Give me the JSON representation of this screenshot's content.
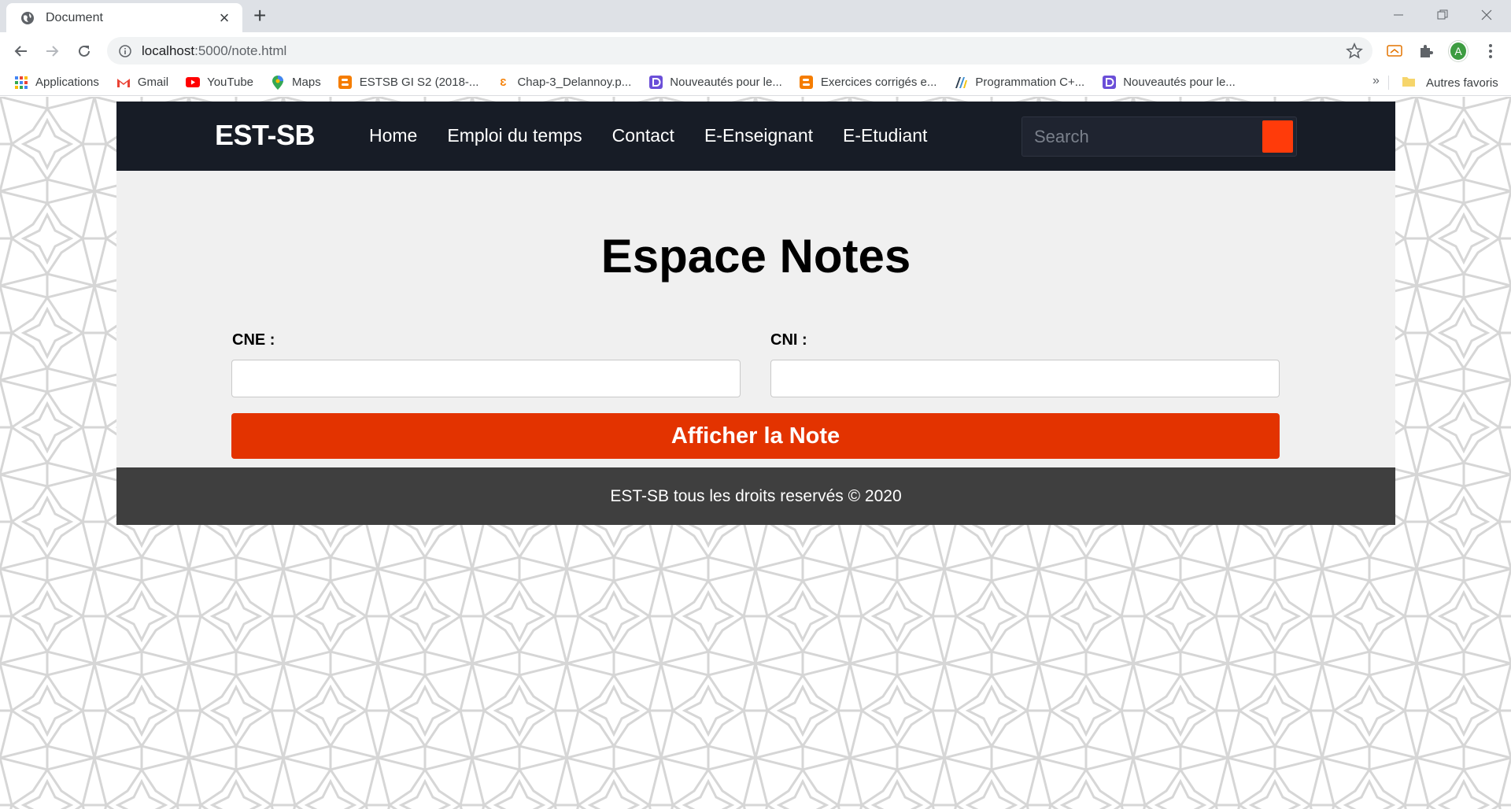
{
  "browser": {
    "tab_title": "Document",
    "url_host": "localhost",
    "url_path": ":5000/note.html",
    "profile_initial": "A",
    "bookmarks": [
      {
        "label": "Applications",
        "icon": "apps-grid-icon"
      },
      {
        "label": "Gmail",
        "icon": "gmail-icon"
      },
      {
        "label": "YouTube",
        "icon": "youtube-icon"
      },
      {
        "label": "Maps",
        "icon": "maps-icon"
      },
      {
        "label": "ESTSB GI S2 (2018-...",
        "icon": "blogger-icon"
      },
      {
        "label": "Chap-3_Delannoy.p...",
        "icon": "doc-e-icon"
      },
      {
        "label": "Nouveautés pour le...",
        "icon": "purple-d-icon"
      },
      {
        "label": "Exercices corrigés e...",
        "icon": "blogger-icon"
      },
      {
        "label": "Programmation C+...",
        "icon": "programming-icon"
      },
      {
        "label": "Nouveautés pour le...",
        "icon": "purple-d-icon"
      }
    ],
    "more_bookmarks": "»",
    "other_bookmarks": "Autres favoris"
  },
  "site": {
    "brand": "EST-SB",
    "nav": [
      "Home",
      "Emploi du temps",
      "Contact",
      "E-Enseignant",
      "E-Etudiant"
    ],
    "search_placeholder": "Search",
    "accent_color": "#ff3b0a"
  },
  "main": {
    "heading": "Espace Notes",
    "cne_label": "CNE :",
    "cni_label": "CNI :",
    "cne_value": "",
    "cni_value": "",
    "submit_label": "Afficher la Note",
    "button_color": "#e33300"
  },
  "footer": {
    "text": "EST-SB tous les droits reservés © 2020"
  }
}
